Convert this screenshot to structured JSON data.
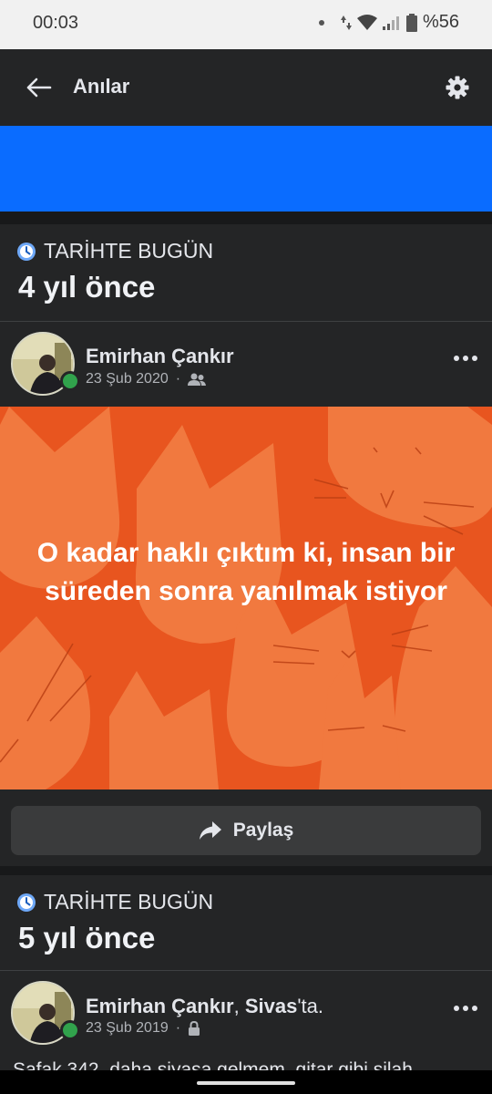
{
  "status_bar": {
    "time": "00:03",
    "battery": "%56"
  },
  "app_bar": {
    "title": "Anılar"
  },
  "memories": [
    {
      "kicker": "TARİHTE BUGÜN",
      "title": "4 yıl önce",
      "post": {
        "author": "Emirhan Çankır",
        "date": "23 Şub 2020",
        "audience_icon": "friends-icon",
        "image_text": "O kadar haklı çıktım ki, insan bir süreden sonra yanılmak istiyor",
        "image_bg": "#e8551f"
      },
      "share_label": "Paylaş"
    },
    {
      "kicker": "TARİHTE BUGÜN",
      "title": "5 yıl önce",
      "post": {
        "author": "Emirhan Çankır",
        "place_separator": ", ",
        "place": "Sivas",
        "place_suffix": "'ta.",
        "date": "23 Şub 2019",
        "audience_icon": "lock-icon",
        "text": "Şafak 342, daha siyasa gelmem, gitar gibi silah"
      }
    }
  ],
  "colors": {
    "accent": "#0a6cff",
    "online": "#31a24c",
    "surface": "#242526"
  }
}
